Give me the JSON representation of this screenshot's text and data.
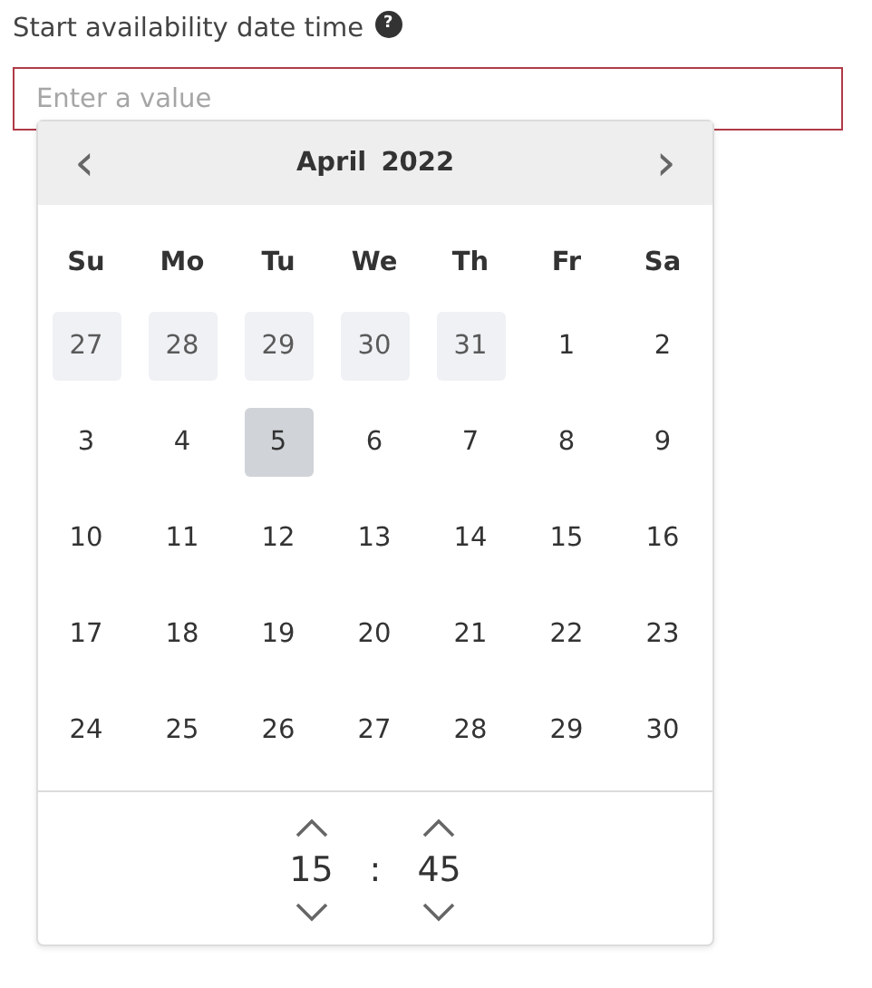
{
  "field": {
    "label": "Start availability date time",
    "help": "?",
    "placeholder": "Enter a value",
    "invalid": true
  },
  "calendar": {
    "prev": "‹",
    "next": "›",
    "month": "April",
    "year": "2022",
    "weekdays": [
      "Su",
      "Mo",
      "Tu",
      "We",
      "Th",
      "Fr",
      "Sa"
    ],
    "weeks": [
      [
        {
          "day": "27",
          "outside": true,
          "selected": false
        },
        {
          "day": "28",
          "outside": true,
          "selected": false
        },
        {
          "day": "29",
          "outside": true,
          "selected": false
        },
        {
          "day": "30",
          "outside": true,
          "selected": false
        },
        {
          "day": "31",
          "outside": true,
          "selected": false
        },
        {
          "day": "1",
          "outside": false,
          "selected": false
        },
        {
          "day": "2",
          "outside": false,
          "selected": false
        }
      ],
      [
        {
          "day": "3",
          "outside": false,
          "selected": false
        },
        {
          "day": "4",
          "outside": false,
          "selected": false
        },
        {
          "day": "5",
          "outside": false,
          "selected": true
        },
        {
          "day": "6",
          "outside": false,
          "selected": false
        },
        {
          "day": "7",
          "outside": false,
          "selected": false
        },
        {
          "day": "8",
          "outside": false,
          "selected": false
        },
        {
          "day": "9",
          "outside": false,
          "selected": false
        }
      ],
      [
        {
          "day": "10",
          "outside": false,
          "selected": false
        },
        {
          "day": "11",
          "outside": false,
          "selected": false
        },
        {
          "day": "12",
          "outside": false,
          "selected": false
        },
        {
          "day": "13",
          "outside": false,
          "selected": false
        },
        {
          "day": "14",
          "outside": false,
          "selected": false
        },
        {
          "day": "15",
          "outside": false,
          "selected": false
        },
        {
          "day": "16",
          "outside": false,
          "selected": false
        }
      ],
      [
        {
          "day": "17",
          "outside": false,
          "selected": false
        },
        {
          "day": "18",
          "outside": false,
          "selected": false
        },
        {
          "day": "19",
          "outside": false,
          "selected": false
        },
        {
          "day": "20",
          "outside": false,
          "selected": false
        },
        {
          "day": "21",
          "outside": false,
          "selected": false
        },
        {
          "day": "22",
          "outside": false,
          "selected": false
        },
        {
          "day": "23",
          "outside": false,
          "selected": false
        }
      ],
      [
        {
          "day": "24",
          "outside": false,
          "selected": false
        },
        {
          "day": "25",
          "outside": false,
          "selected": false
        },
        {
          "day": "26",
          "outside": false,
          "selected": false
        },
        {
          "day": "27",
          "outside": false,
          "selected": false
        },
        {
          "day": "28",
          "outside": false,
          "selected": false
        },
        {
          "day": "29",
          "outside": false,
          "selected": false
        },
        {
          "day": "30",
          "outside": false,
          "selected": false
        }
      ]
    ]
  },
  "time": {
    "hours": "15",
    "separator": ":",
    "minutes": "45"
  }
}
